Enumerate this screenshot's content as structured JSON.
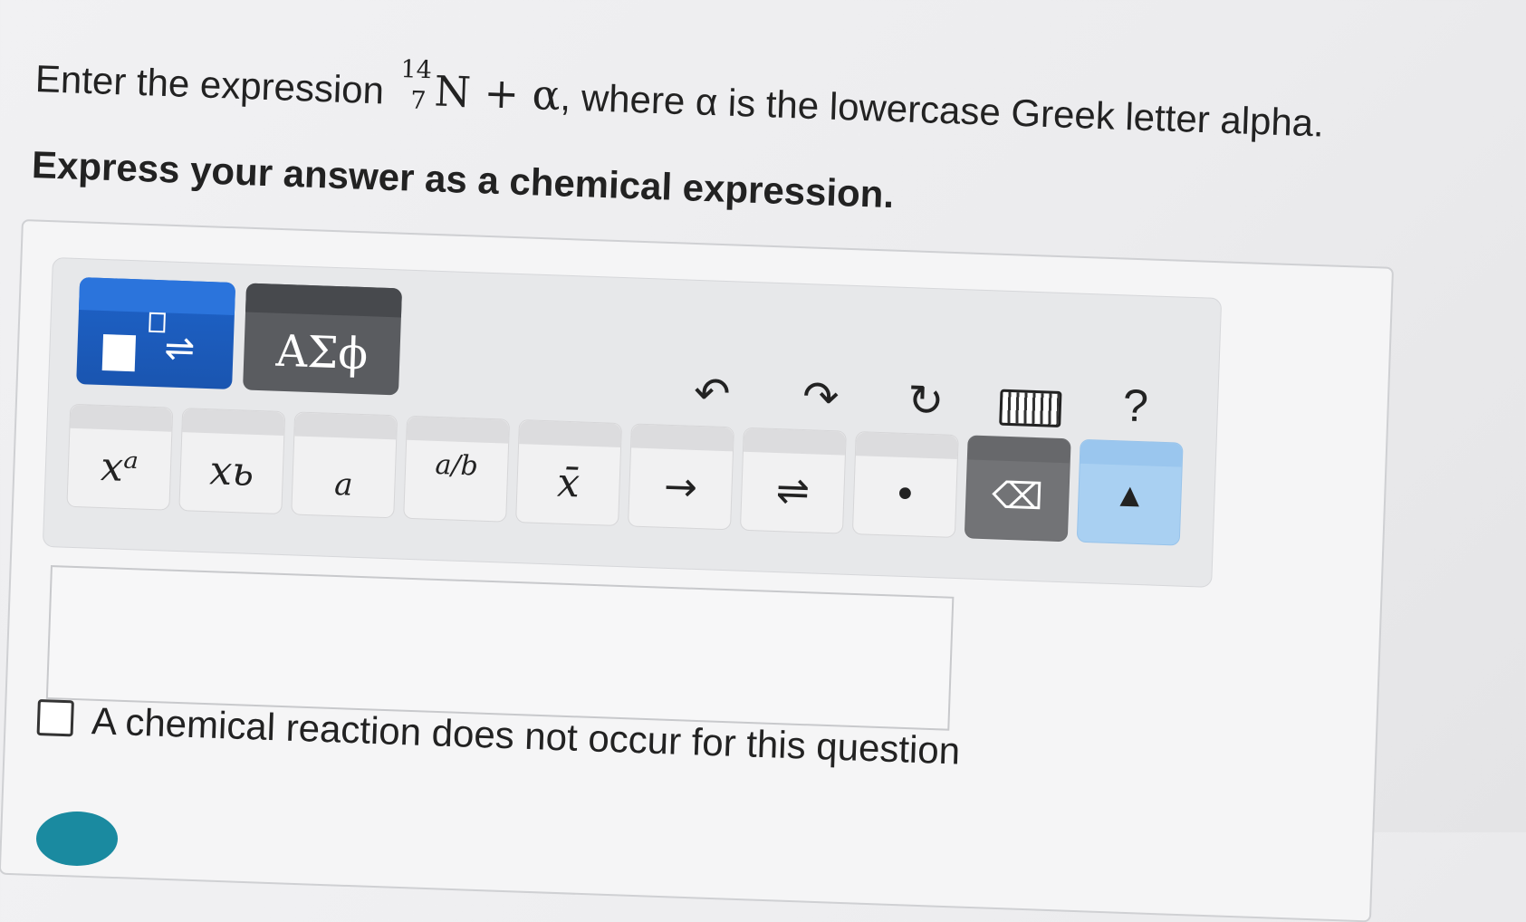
{
  "question": {
    "line1_before": "Enter the expression ",
    "nuclide": {
      "mass": "14",
      "atomic": "7",
      "symbol": "N"
    },
    "plus_alpha": " + α",
    "line1_after": ", where α is the lowercase Greek letter alpha.",
    "line2": "Express your answer as a chemical expression."
  },
  "toolbar": {
    "tab_templates_icon": "templates-equilibrium-icon",
    "tab_greek_label": "ΑΣϕ",
    "undo": "↶",
    "redo": "↷",
    "reset": "↻",
    "help": "?",
    "keys": [
      {
        "name": "superscript-key",
        "label": "xᵃ"
      },
      {
        "name": "subscript-key",
        "label": "xь"
      },
      {
        "name": "script-key",
        "label": "a"
      },
      {
        "name": "fraction-key",
        "label": "a/b"
      },
      {
        "name": "overbar-key",
        "label": "x̄"
      },
      {
        "name": "reaction-arrow-key",
        "label": "→"
      },
      {
        "name": "equilibrium-arrow-key",
        "label": "⇌"
      },
      {
        "name": "dot-key",
        "label": "•"
      },
      {
        "name": "backspace-key",
        "label": "⌫"
      },
      {
        "name": "keyboard-toggle-key",
        "label": "▲"
      }
    ]
  },
  "answer_placeholder": "",
  "no_reaction_label": "A chemical reaction does not occur for this question"
}
